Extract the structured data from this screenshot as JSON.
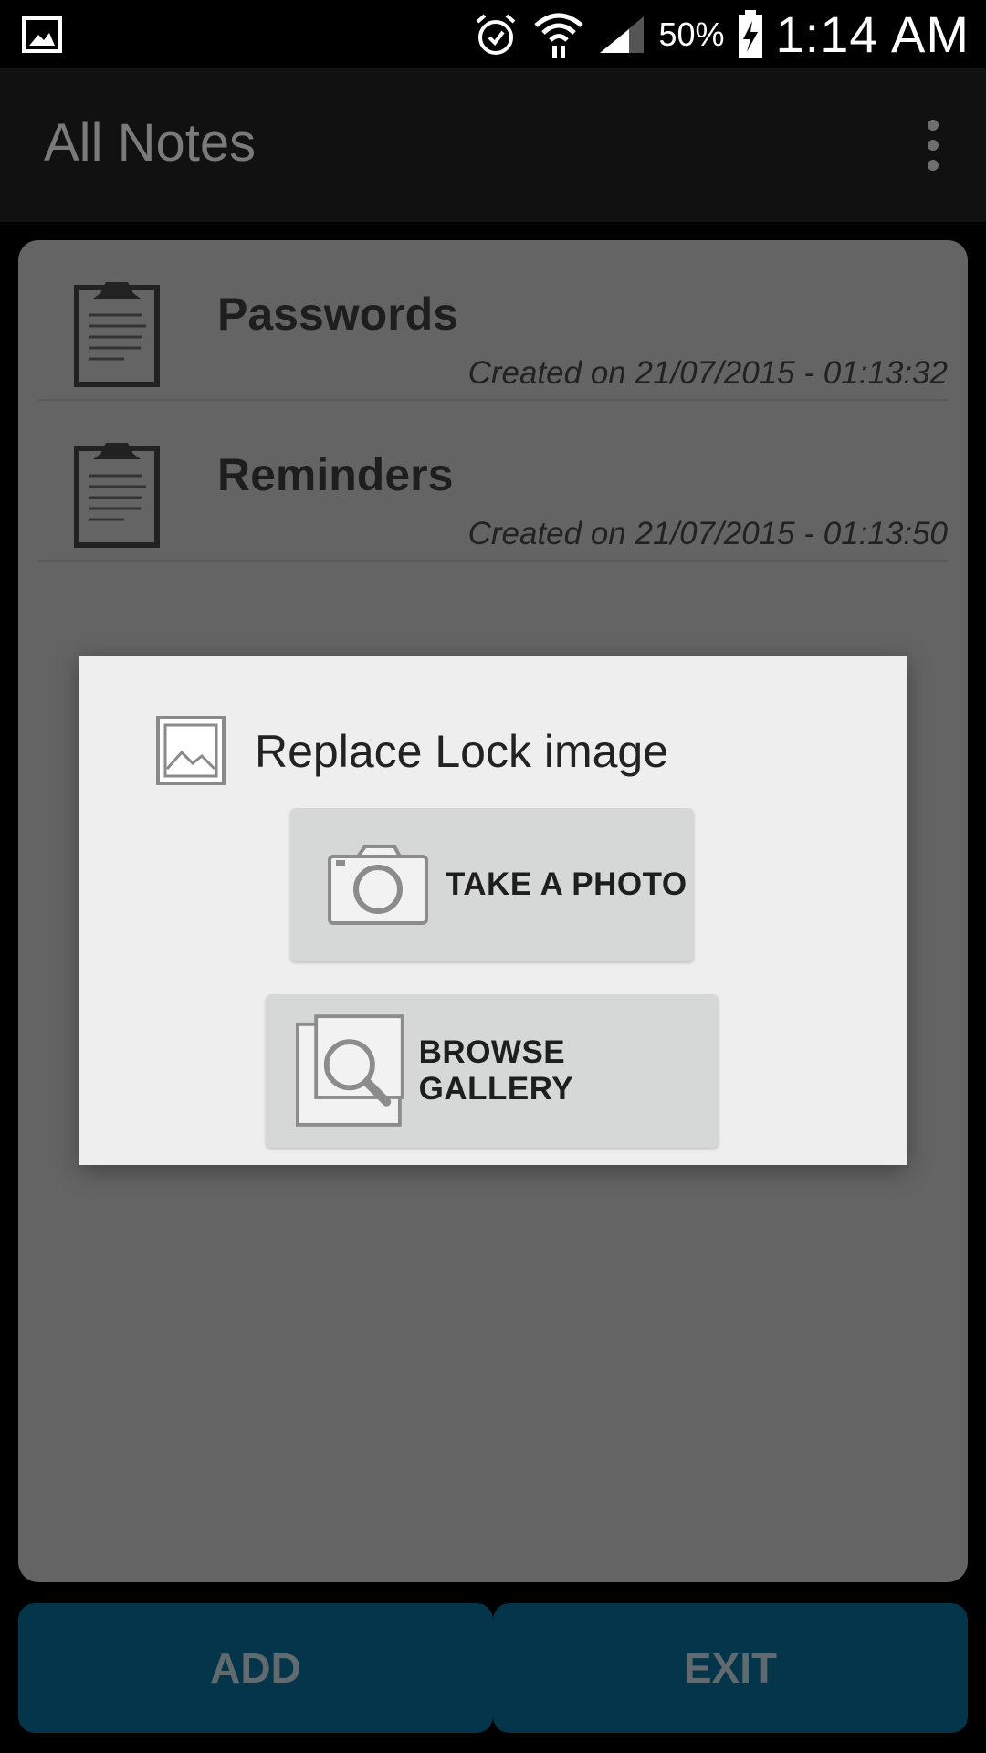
{
  "status_bar": {
    "battery": "50%",
    "time": "1:14 AM",
    "icons": [
      "gallery-notification-icon",
      "alarm-icon",
      "wifi-icon",
      "signal-icon",
      "battery-charging-icon"
    ]
  },
  "app_bar": {
    "title": "All Notes",
    "menu_icon": "overflow-menu-icon"
  },
  "notes": [
    {
      "title": "Passwords",
      "date": "Created on 21/07/2015 - 01:13:32",
      "icon": "clipboard-icon"
    },
    {
      "title": "Reminders",
      "date": "Created on 21/07/2015 - 01:13:50",
      "icon": "clipboard-icon"
    }
  ],
  "dialog": {
    "title": "Replace Lock image",
    "icon": "image-icon",
    "take_photo_label": "TAKE A PHOTO",
    "browse_gallery_label": "BROWSE GALLERY"
  },
  "bottom": {
    "add_label": "ADD",
    "exit_label": "EXIT"
  },
  "colors": {
    "bottom_button": "#04354a",
    "card": "#646464",
    "dialog": "#eeeeee"
  }
}
